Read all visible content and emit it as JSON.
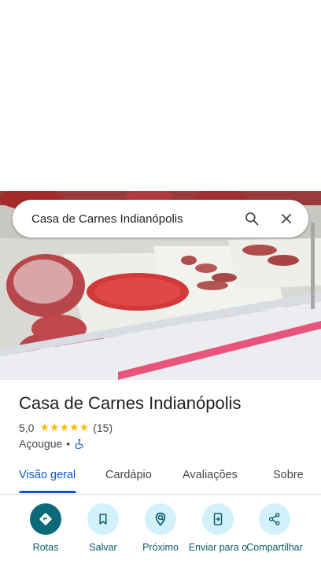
{
  "search": {
    "query": "Casa de Carnes Indianópolis"
  },
  "place": {
    "title": "Casa de Carnes Indianópolis",
    "rating": "5,0",
    "stars": "★★★★★",
    "review_count": "(15)",
    "category": "Açougue",
    "separator": "•"
  },
  "tabs": [
    {
      "label": "Visão geral",
      "active": true
    },
    {
      "label": "Cardápio",
      "active": false
    },
    {
      "label": "Avaliações",
      "active": false
    },
    {
      "label": "Sobre",
      "active": false
    }
  ],
  "actions": [
    {
      "label": "Rotas",
      "icon": "directions-icon"
    },
    {
      "label": "Salvar",
      "icon": "bookmark-icon"
    },
    {
      "label": "Próximo",
      "icon": "nearby-icon"
    },
    {
      "label": "Enviar para o",
      "icon": "send-to-phone-icon"
    },
    {
      "label": "Compartilhar",
      "icon": "share-icon"
    }
  ],
  "colors": {
    "accent": "#0b57d0",
    "action_primary": "#0a6a7a",
    "action_secondary": "#d3f1fb",
    "star": "#fbbc04"
  }
}
